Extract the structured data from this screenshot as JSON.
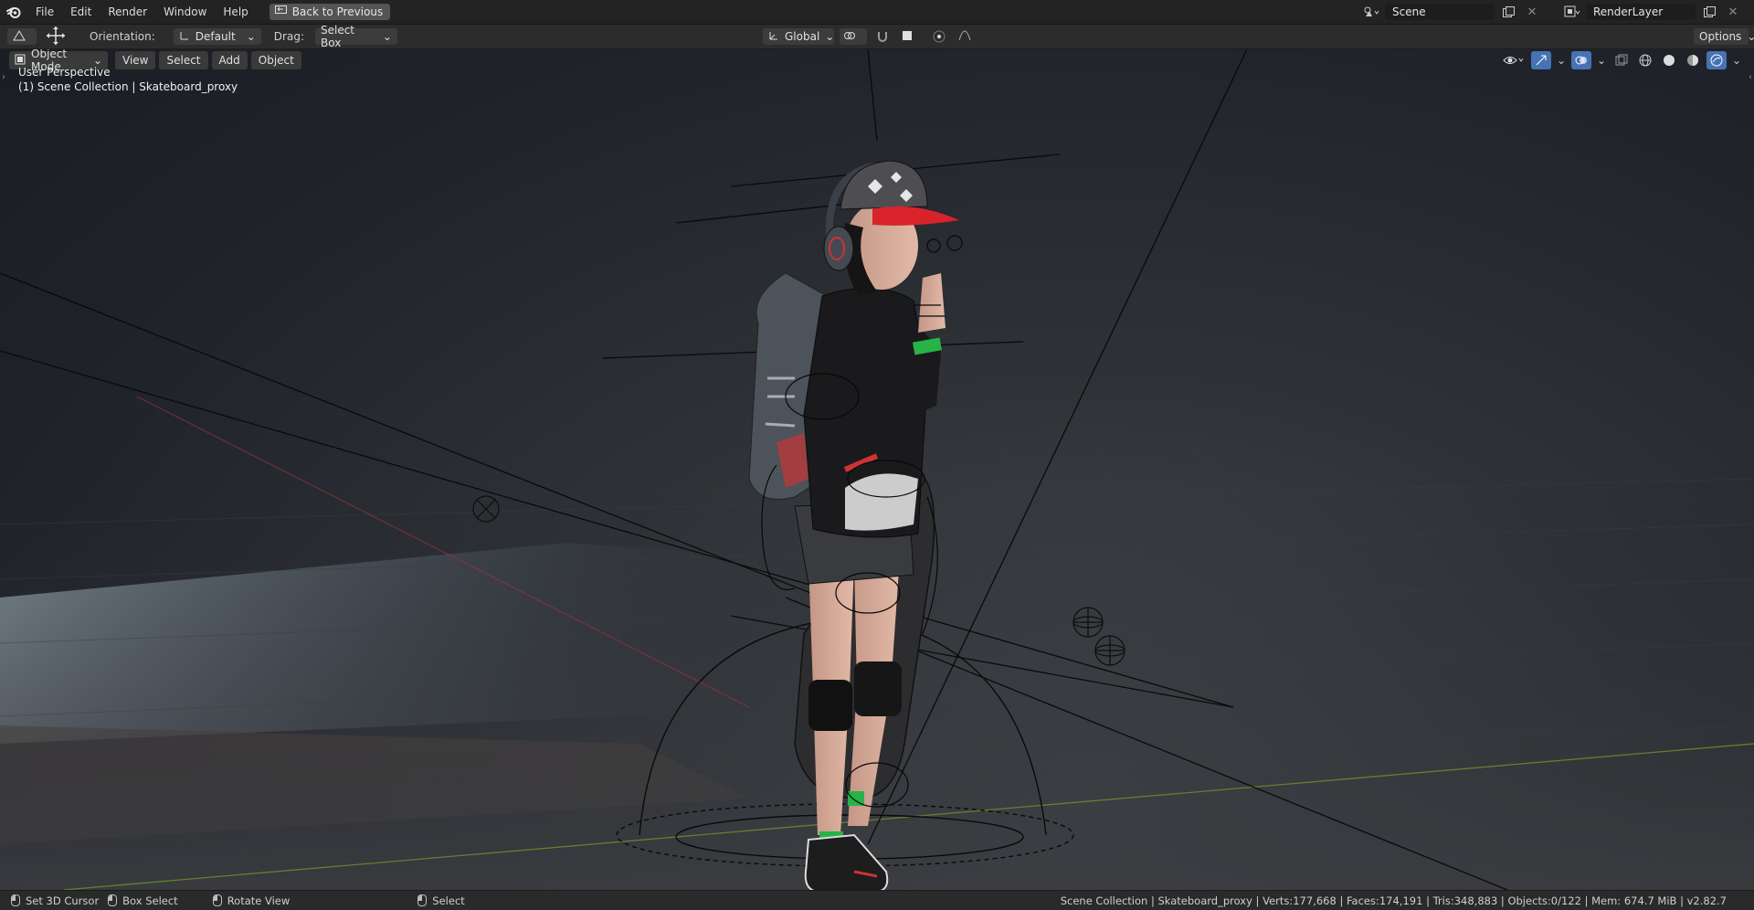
{
  "menubar": {
    "items": [
      "File",
      "Edit",
      "Render",
      "Window",
      "Help"
    ],
    "back_button": "Back to Previous",
    "scene": "Scene",
    "render_layer": "RenderLayer"
  },
  "toolbar": {
    "orientation_label": "Orientation:",
    "orientation_value": "Default",
    "drag_label": "Drag:",
    "drag_value": "Select Box",
    "transform_orientation": "Global",
    "options_label": "Options"
  },
  "viewport_header": {
    "mode": "Object Mode",
    "menus": [
      "View",
      "Select",
      "Add",
      "Object"
    ]
  },
  "viewport": {
    "perspective": "User Perspective",
    "active_object": "(1) Scene Collection | Skateboard_proxy"
  },
  "statusbar": {
    "set_cursor": "Set 3D Cursor",
    "box_select": "Box Select",
    "rotate_view": "Rotate View",
    "select": "Select",
    "stats": "Scene Collection | Skateboard_proxy | Verts:177,668 | Faces:174,191 | Tris:348,883 | Objects:0/122 | Mem: 674.7 MiB | v2.82.7"
  },
  "colors": {
    "accent_blue": "#4772b3",
    "cap_red": "#d8232a",
    "wristband_green": "#2db84b"
  }
}
